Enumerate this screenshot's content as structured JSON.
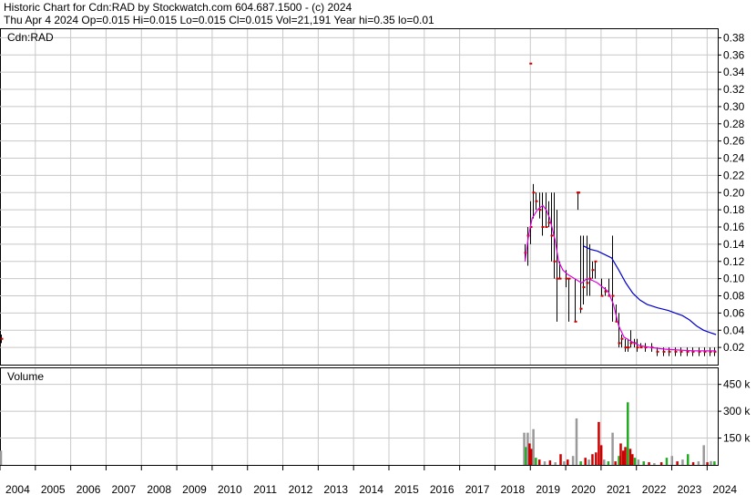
{
  "header": {
    "line1": "Historic Chart for Cdn:RAD by Stockwatch.com 604.687.1500 - (c) 2024",
    "line2": "Thu Apr  4 2024   Op=0.015   Hi=0.015   Lo=0.015   Cl=0.015   Vol=21,191   Year hi=0.35   lo=0.01"
  },
  "colors": {
    "grid": "#c8c8c8",
    "ohlc": "#000000",
    "close_mark": "#cc0000",
    "ma_fast": "#e000e0",
    "ma_slow": "#0000cc",
    "vol_up": "#22aa22",
    "vol_down": "#cc0000",
    "vol_flat": "#999999"
  },
  "chart_data": [
    {
      "type": "line",
      "title": "",
      "symbol_label": "Cdn:RAD",
      "xlabel": "",
      "ylabel": "",
      "x_ticks": [
        "2004",
        "2005",
        "2006",
        "2007",
        "2008",
        "2009",
        "2010",
        "2011",
        "2012",
        "2013",
        "2014",
        "2015",
        "2016",
        "2017",
        "2018",
        "2019",
        "2020",
        "2021",
        "2022",
        "2023",
        "2024"
      ],
      "xlim": [
        2004.0,
        2024.3
      ],
      "y_ticks": [
        "0.02",
        "0.04",
        "0.06",
        "0.08",
        "0.10",
        "0.12",
        "0.14",
        "0.16",
        "0.18",
        "0.20",
        "0.22",
        "0.24",
        "0.26",
        "0.28",
        "0.30",
        "0.32",
        "0.34",
        "0.36",
        "0.38"
      ],
      "ylim": [
        0.0,
        0.39
      ],
      "grid": true,
      "ohlc": [
        {
          "x": 2004.02,
          "h": 0.035,
          "l": 0.025,
          "c": 0.03
        },
        {
          "x": 2018.85,
          "h": 0.14,
          "l": 0.12,
          "c": 0.13
        },
        {
          "x": 2018.92,
          "h": 0.16,
          "l": 0.115,
          "c": 0.15
        },
        {
          "x": 2019.0,
          "h": 0.19,
          "l": 0.14,
          "c": 0.16
        },
        {
          "x": 2019.08,
          "h": 0.21,
          "l": 0.17,
          "c": 0.2
        },
        {
          "x": 2019.15,
          "h": 0.2,
          "l": 0.18,
          "c": 0.19
        },
        {
          "x": 2019.25,
          "h": 0.2,
          "l": 0.17,
          "c": 0.18
        },
        {
          "x": 2019.33,
          "h": 0.2,
          "l": 0.15,
          "c": 0.16
        },
        {
          "x": 2019.42,
          "h": 0.2,
          "l": 0.16,
          "c": 0.16
        },
        {
          "x": 2019.5,
          "h": 0.19,
          "l": 0.16,
          "c": 0.165
        },
        {
          "x": 2019.58,
          "h": 0.2,
          "l": 0.12,
          "c": 0.15
        },
        {
          "x": 2019.67,
          "h": 0.2,
          "l": 0.1,
          "c": 0.12
        },
        {
          "x": 2019.75,
          "h": 0.18,
          "l": 0.05,
          "c": 0.1
        },
        {
          "x": 2019.83,
          "h": 0.12,
          "l": 0.1,
          "c": 0.1
        },
        {
          "x": 2020.0,
          "h": 0.11,
          "l": 0.09,
          "c": 0.1
        },
        {
          "x": 2020.08,
          "h": 0.1,
          "l": 0.05,
          "c": 0.1
        },
        {
          "x": 2020.25,
          "h": 0.1,
          "l": 0.05,
          "c": 0.05
        },
        {
          "x": 2020.33,
          "h": 0.2,
          "l": 0.18,
          "c": 0.2
        },
        {
          "x": 2020.42,
          "h": 0.15,
          "l": 0.06,
          "c": 0.065
        },
        {
          "x": 2020.5,
          "h": 0.15,
          "l": 0.07,
          "c": 0.09
        },
        {
          "x": 2020.58,
          "h": 0.15,
          "l": 0.08,
          "c": 0.095
        },
        {
          "x": 2020.67,
          "h": 0.14,
          "l": 0.08,
          "c": 0.1
        },
        {
          "x": 2020.75,
          "h": 0.12,
          "l": 0.1,
          "c": 0.11
        },
        {
          "x": 2020.83,
          "h": 0.12,
          "l": 0.1,
          "c": 0.12
        },
        {
          "x": 2021.0,
          "h": 0.1,
          "l": 0.08,
          "c": 0.08
        },
        {
          "x": 2021.1,
          "h": 0.09,
          "l": 0.08,
          "c": 0.085
        },
        {
          "x": 2021.2,
          "h": 0.1,
          "l": 0.08,
          "c": 0.08
        },
        {
          "x": 2021.3,
          "h": 0.15,
          "l": 0.05,
          "c": 0.08
        },
        {
          "x": 2021.42,
          "h": 0.07,
          "l": 0.05,
          "c": 0.05
        },
        {
          "x": 2021.5,
          "h": 0.06,
          "l": 0.02,
          "c": 0.025
        },
        {
          "x": 2021.58,
          "h": 0.035,
          "l": 0.02,
          "c": 0.03
        },
        {
          "x": 2021.67,
          "h": 0.03,
          "l": 0.015,
          "c": 0.02
        },
        {
          "x": 2021.75,
          "h": 0.03,
          "l": 0.015,
          "c": 0.02
        },
        {
          "x": 2021.83,
          "h": 0.04,
          "l": 0.02,
          "c": 0.025
        },
        {
          "x": 2021.92,
          "h": 0.03,
          "l": 0.02,
          "c": 0.025
        },
        {
          "x": 2022.0,
          "h": 0.03,
          "l": 0.015,
          "c": 0.02
        },
        {
          "x": 2022.1,
          "h": 0.025,
          "l": 0.02,
          "c": 0.02
        },
        {
          "x": 2022.25,
          "h": 0.025,
          "l": 0.015,
          "c": 0.02
        },
        {
          "x": 2022.42,
          "h": 0.025,
          "l": 0.015,
          "c": 0.02
        },
        {
          "x": 2022.58,
          "h": 0.02,
          "l": 0.01,
          "c": 0.015
        },
        {
          "x": 2022.75,
          "h": 0.02,
          "l": 0.01,
          "c": 0.015
        },
        {
          "x": 2022.92,
          "h": 0.02,
          "l": 0.01,
          "c": 0.015
        },
        {
          "x": 2023.08,
          "h": 0.02,
          "l": 0.01,
          "c": 0.015
        },
        {
          "x": 2023.25,
          "h": 0.02,
          "l": 0.01,
          "c": 0.015
        },
        {
          "x": 2023.42,
          "h": 0.02,
          "l": 0.01,
          "c": 0.015
        },
        {
          "x": 2023.58,
          "h": 0.02,
          "l": 0.01,
          "c": 0.015
        },
        {
          "x": 2023.75,
          "h": 0.02,
          "l": 0.01,
          "c": 0.015
        },
        {
          "x": 2023.92,
          "h": 0.02,
          "l": 0.01,
          "c": 0.015
        },
        {
          "x": 2024.08,
          "h": 0.02,
          "l": 0.01,
          "c": 0.015
        },
        {
          "x": 2024.2,
          "h": 0.02,
          "l": 0.01,
          "c": 0.015
        }
      ],
      "close_marks": [
        {
          "x": 2019.0,
          "y": 0.35
        },
        {
          "x": 2020.33,
          "y": 0.2
        },
        {
          "x": 2020.36,
          "y": 0.2
        }
      ],
      "series": [
        {
          "role": "fast_moving_average",
          "color": "#e000e0",
          "points": [
            [
              2018.85,
              0.12
            ],
            [
              2018.95,
              0.15
            ],
            [
              2019.05,
              0.17
            ],
            [
              2019.2,
              0.18
            ],
            [
              2019.35,
              0.185
            ],
            [
              2019.45,
              0.18
            ],
            [
              2019.55,
              0.17
            ],
            [
              2019.7,
              0.145
            ],
            [
              2019.8,
              0.12
            ],
            [
              2019.92,
              0.11
            ],
            [
              2020.05,
              0.105
            ],
            [
              2020.25,
              0.1
            ],
            [
              2020.45,
              0.095
            ],
            [
              2020.6,
              0.1
            ],
            [
              2020.75,
              0.098
            ],
            [
              2020.9,
              0.095
            ],
            [
              2021.05,
              0.09
            ],
            [
              2021.2,
              0.085
            ],
            [
              2021.35,
              0.07
            ],
            [
              2021.5,
              0.045
            ],
            [
              2021.65,
              0.032
            ],
            [
              2021.85,
              0.027
            ],
            [
              2022.1,
              0.022
            ],
            [
              2022.4,
              0.02
            ],
            [
              2022.8,
              0.018
            ],
            [
              2023.2,
              0.017
            ],
            [
              2023.6,
              0.016
            ],
            [
              2024.0,
              0.016
            ],
            [
              2024.25,
              0.016
            ]
          ]
        },
        {
          "role": "slow_moving_average",
          "color": "#0000cc",
          "points": [
            [
              2020.5,
              0.138
            ],
            [
              2020.7,
              0.134
            ],
            [
              2020.9,
              0.132
            ],
            [
              2021.1,
              0.128
            ],
            [
              2021.3,
              0.124
            ],
            [
              2021.5,
              0.11
            ],
            [
              2021.7,
              0.095
            ],
            [
              2021.9,
              0.083
            ],
            [
              2022.1,
              0.075
            ],
            [
              2022.3,
              0.07
            ],
            [
              2022.6,
              0.066
            ],
            [
              2022.9,
              0.063
            ],
            [
              2023.1,
              0.06
            ],
            [
              2023.3,
              0.057
            ],
            [
              2023.5,
              0.052
            ],
            [
              2023.7,
              0.045
            ],
            [
              2023.9,
              0.04
            ],
            [
              2024.1,
              0.037
            ],
            [
              2024.25,
              0.035
            ]
          ]
        }
      ]
    },
    {
      "type": "bar",
      "title": "Volume",
      "ylabel": "",
      "y_ticks": [
        "150 k",
        "300 k",
        "450 k"
      ],
      "ylim": [
        0,
        540000
      ],
      "grid": true,
      "bars": [
        {
          "x": 2004.02,
          "v": 80000,
          "d": "flat"
        },
        {
          "x": 2018.82,
          "v": 180000,
          "d": "flat"
        },
        {
          "x": 2018.87,
          "v": 100000,
          "d": "up"
        },
        {
          "x": 2018.92,
          "v": 180000,
          "d": "flat"
        },
        {
          "x": 2018.97,
          "v": 120000,
          "d": "down"
        },
        {
          "x": 2019.02,
          "v": 90000,
          "d": "down"
        },
        {
          "x": 2019.08,
          "v": 200000,
          "d": "flat"
        },
        {
          "x": 2019.15,
          "v": 40000,
          "d": "up"
        },
        {
          "x": 2019.25,
          "v": 30000,
          "d": "down"
        },
        {
          "x": 2019.4,
          "v": 20000,
          "d": "flat"
        },
        {
          "x": 2019.55,
          "v": 25000,
          "d": "down"
        },
        {
          "x": 2019.7,
          "v": 15000,
          "d": "flat"
        },
        {
          "x": 2019.85,
          "v": 60000,
          "d": "down"
        },
        {
          "x": 2019.95,
          "v": 20000,
          "d": "flat"
        },
        {
          "x": 2020.05,
          "v": 30000,
          "d": "down"
        },
        {
          "x": 2020.2,
          "v": 50000,
          "d": "flat"
        },
        {
          "x": 2020.3,
          "v": 260000,
          "d": "flat"
        },
        {
          "x": 2020.42,
          "v": 20000,
          "d": "up"
        },
        {
          "x": 2020.55,
          "v": 40000,
          "d": "down"
        },
        {
          "x": 2020.65,
          "v": 30000,
          "d": "flat"
        },
        {
          "x": 2020.75,
          "v": 60000,
          "d": "down"
        },
        {
          "x": 2020.85,
          "v": 70000,
          "d": "down"
        },
        {
          "x": 2020.93,
          "v": 240000,
          "d": "down"
        },
        {
          "x": 2021.0,
          "v": 110000,
          "d": "down"
        },
        {
          "x": 2021.08,
          "v": 30000,
          "d": "flat"
        },
        {
          "x": 2021.2,
          "v": 20000,
          "d": "up"
        },
        {
          "x": 2021.32,
          "v": 180000,
          "d": "flat"
        },
        {
          "x": 2021.4,
          "v": 20000,
          "d": "down"
        },
        {
          "x": 2021.5,
          "v": 50000,
          "d": "up"
        },
        {
          "x": 2021.55,
          "v": 120000,
          "d": "down"
        },
        {
          "x": 2021.62,
          "v": 80000,
          "d": "down"
        },
        {
          "x": 2021.68,
          "v": 100000,
          "d": "down"
        },
        {
          "x": 2021.75,
          "v": 350000,
          "d": "up"
        },
        {
          "x": 2021.82,
          "v": 90000,
          "d": "down"
        },
        {
          "x": 2021.88,
          "v": 60000,
          "d": "down"
        },
        {
          "x": 2021.95,
          "v": 40000,
          "d": "up"
        },
        {
          "x": 2022.05,
          "v": 30000,
          "d": "flat"
        },
        {
          "x": 2022.2,
          "v": 20000,
          "d": "up"
        },
        {
          "x": 2022.35,
          "v": 15000,
          "d": "down"
        },
        {
          "x": 2022.5,
          "v": 10000,
          "d": "flat"
        },
        {
          "x": 2022.7,
          "v": 15000,
          "d": "down"
        },
        {
          "x": 2022.85,
          "v": 40000,
          "d": "up"
        },
        {
          "x": 2023.0,
          "v": 50000,
          "d": "flat"
        },
        {
          "x": 2023.15,
          "v": 20000,
          "d": "down"
        },
        {
          "x": 2023.3,
          "v": 30000,
          "d": "flat"
        },
        {
          "x": 2023.45,
          "v": 60000,
          "d": "up"
        },
        {
          "x": 2023.6,
          "v": 15000,
          "d": "down"
        },
        {
          "x": 2023.75,
          "v": 20000,
          "d": "flat"
        },
        {
          "x": 2023.9,
          "v": 110000,
          "d": "flat"
        },
        {
          "x": 2024.0,
          "v": 15000,
          "d": "down"
        },
        {
          "x": 2024.1,
          "v": 21191,
          "d": "flat"
        },
        {
          "x": 2024.2,
          "v": 20000,
          "d": "up"
        }
      ]
    }
  ]
}
